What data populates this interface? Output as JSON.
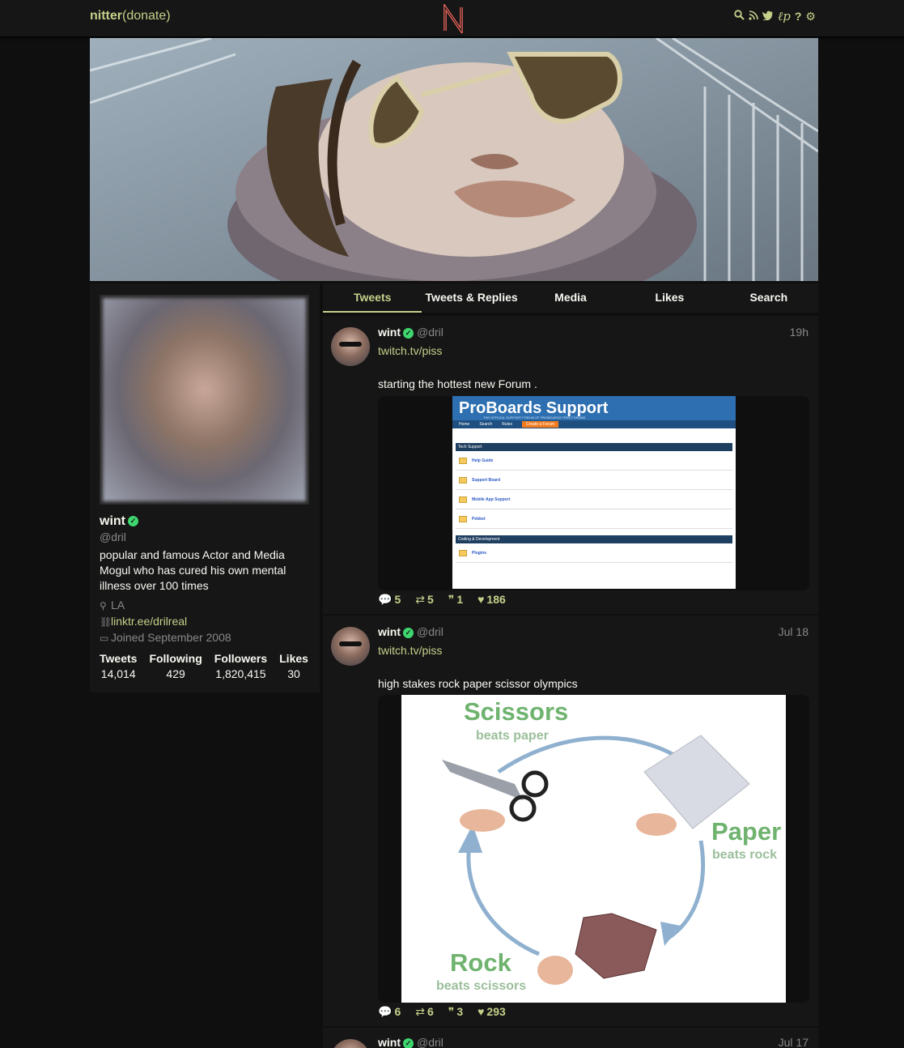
{
  "navbar": {
    "brand": "nitter",
    "donate": "(donate)",
    "logo_letter": "N",
    "icons": [
      "search-icon",
      "rss-icon",
      "twitter-icon",
      "lp-icon",
      "help-icon",
      "gear-icon"
    ]
  },
  "profile": {
    "name": "wint",
    "handle": "@dril",
    "bio": "popular and famous Actor and Media Mogul who has cured his own mental illness over 100 times",
    "location": "LA",
    "website": "linktr.ee/drilreal",
    "joined": "Joined September 2008",
    "stats": [
      {
        "label": "Tweets",
        "value": "14,014"
      },
      {
        "label": "Following",
        "value": "429"
      },
      {
        "label": "Followers",
        "value": "1,820,415"
      },
      {
        "label": "Likes",
        "value": "30"
      }
    ]
  },
  "tabs": [
    "Tweets",
    "Tweets & Replies",
    "Media",
    "Likes",
    "Search"
  ],
  "active_tab": "Tweets",
  "tweets": [
    {
      "name": "wint",
      "handle": "@dril",
      "date": "19h",
      "link": "twitch.tv/piss",
      "text": "starting the hottest new Forum .",
      "replies": "5",
      "retweets": "5",
      "quotes": "1",
      "likes": "186",
      "media": {
        "title": "ProBoards Support",
        "subtitle": "THE OFFICIAL SUPPORT FORUM OF PROBOARDS FREE FORUMS",
        "nav": [
          "Home",
          "Search",
          "Rules",
          "Create a Forum"
        ],
        "sections": [
          "Tech Support",
          "Coding & Development"
        ],
        "boards": [
          "Help Guide",
          "Support Board",
          "Mobile App Support",
          "Pebbet",
          "Plugins"
        ]
      }
    },
    {
      "name": "wint",
      "handle": "@dril",
      "date": "Jul 18",
      "link": "twitch.tv/piss",
      "text": "high stakes rock paper scissor olympics",
      "replies": "6",
      "retweets": "6",
      "quotes": "3",
      "likes": "293",
      "media": {
        "scissors": "Scissors",
        "scissors_sub": "beats paper",
        "paper": "Paper",
        "paper_sub": "beats rock",
        "rock": "Rock",
        "rock_sub": "beats scissors"
      }
    },
    {
      "name": "wint",
      "handle": "@dril",
      "date": "Jul 17"
    }
  ],
  "colors": {
    "accent": "#ff6c60",
    "background": "#0f0f0f",
    "panel": "#161616",
    "verified": "#3ed66e"
  }
}
